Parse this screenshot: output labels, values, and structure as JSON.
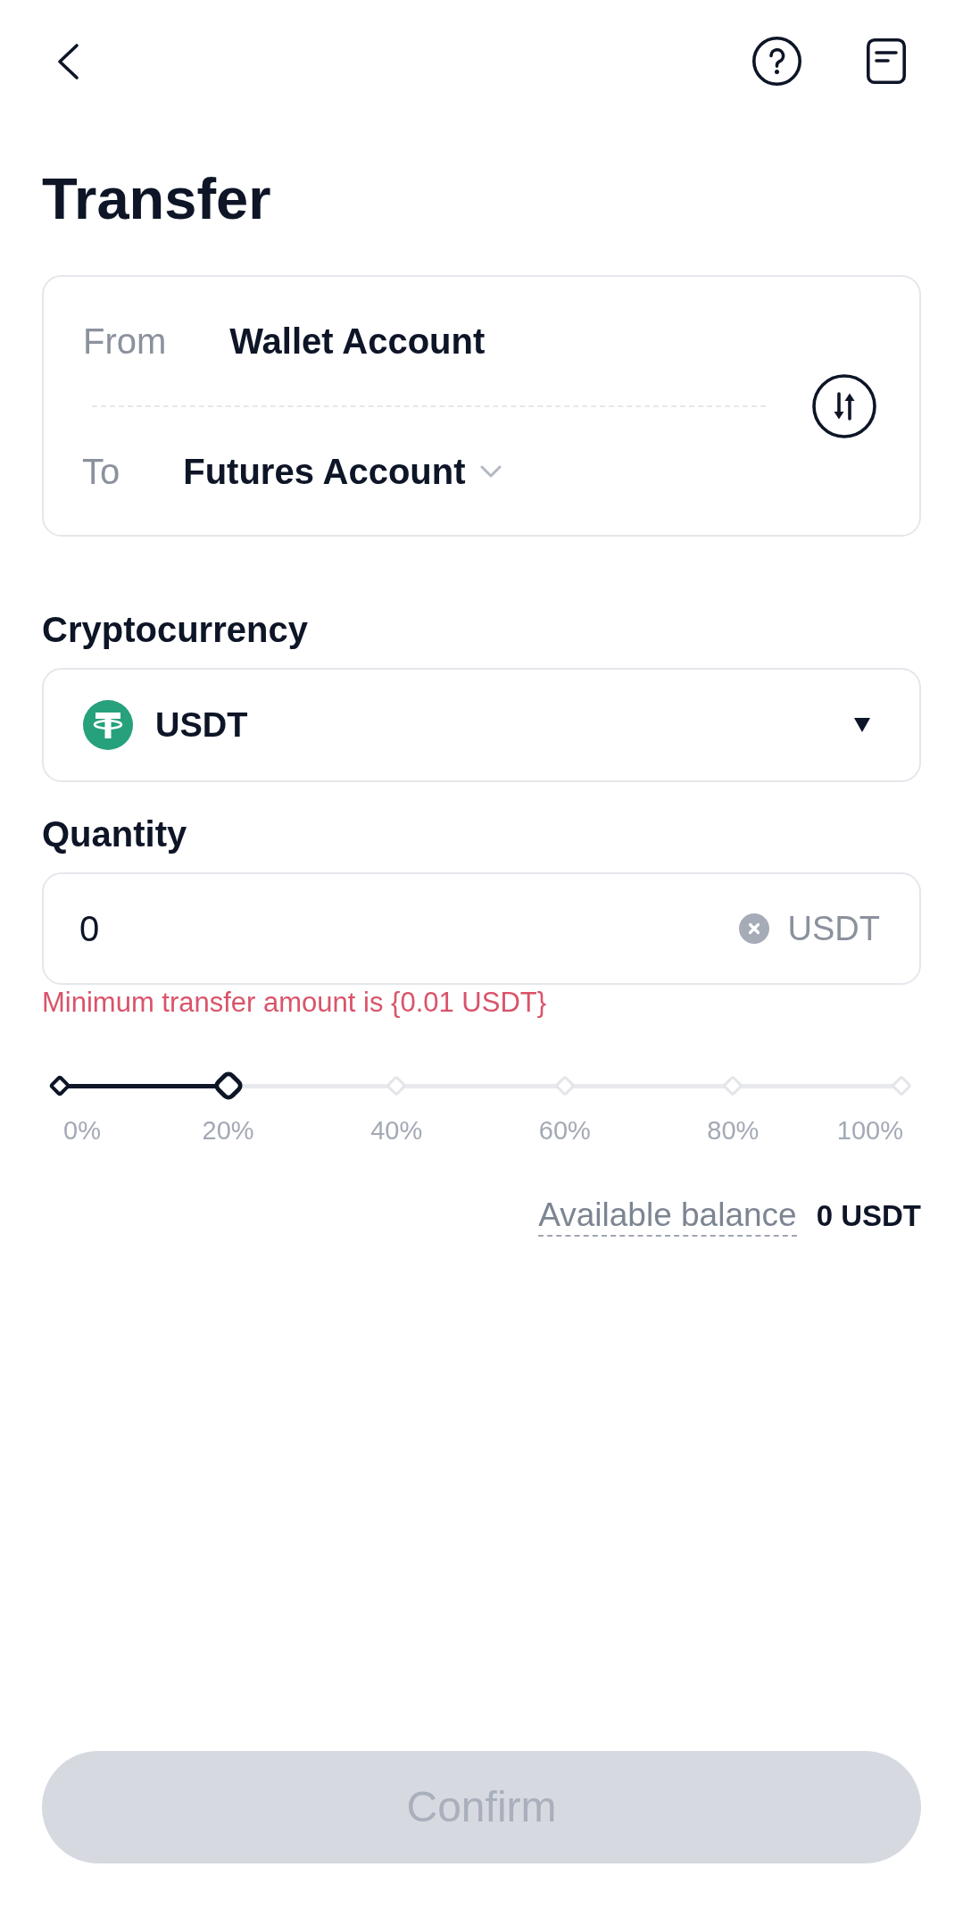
{
  "header": {
    "title": "Transfer"
  },
  "accounts": [
    {
      "label": "From",
      "account": "Wallet Account",
      "dropdown": false
    },
    {
      "label": "To",
      "account": "Futures Account",
      "dropdown": true
    }
  ],
  "cryptocurrency": {
    "label": "Cryptocurrency",
    "value": "USDT"
  },
  "quantity": {
    "label": "Quantity",
    "value": "0",
    "unit": "USDT",
    "error": "Minimum transfer amount is {0.01 USDT}"
  },
  "slider": {
    "level": 0.2,
    "steps": [
      {
        "label": "0%"
      },
      {
        "label": "20%"
      },
      {
        "label": "40%"
      },
      {
        "label": "60%"
      },
      {
        "label": "80%"
      },
      {
        "label": "100%"
      }
    ]
  },
  "balance": {
    "label": "Available balance",
    "value": "0 USDT"
  },
  "confirm": {
    "label": "Confirm",
    "disabled": true
  }
}
